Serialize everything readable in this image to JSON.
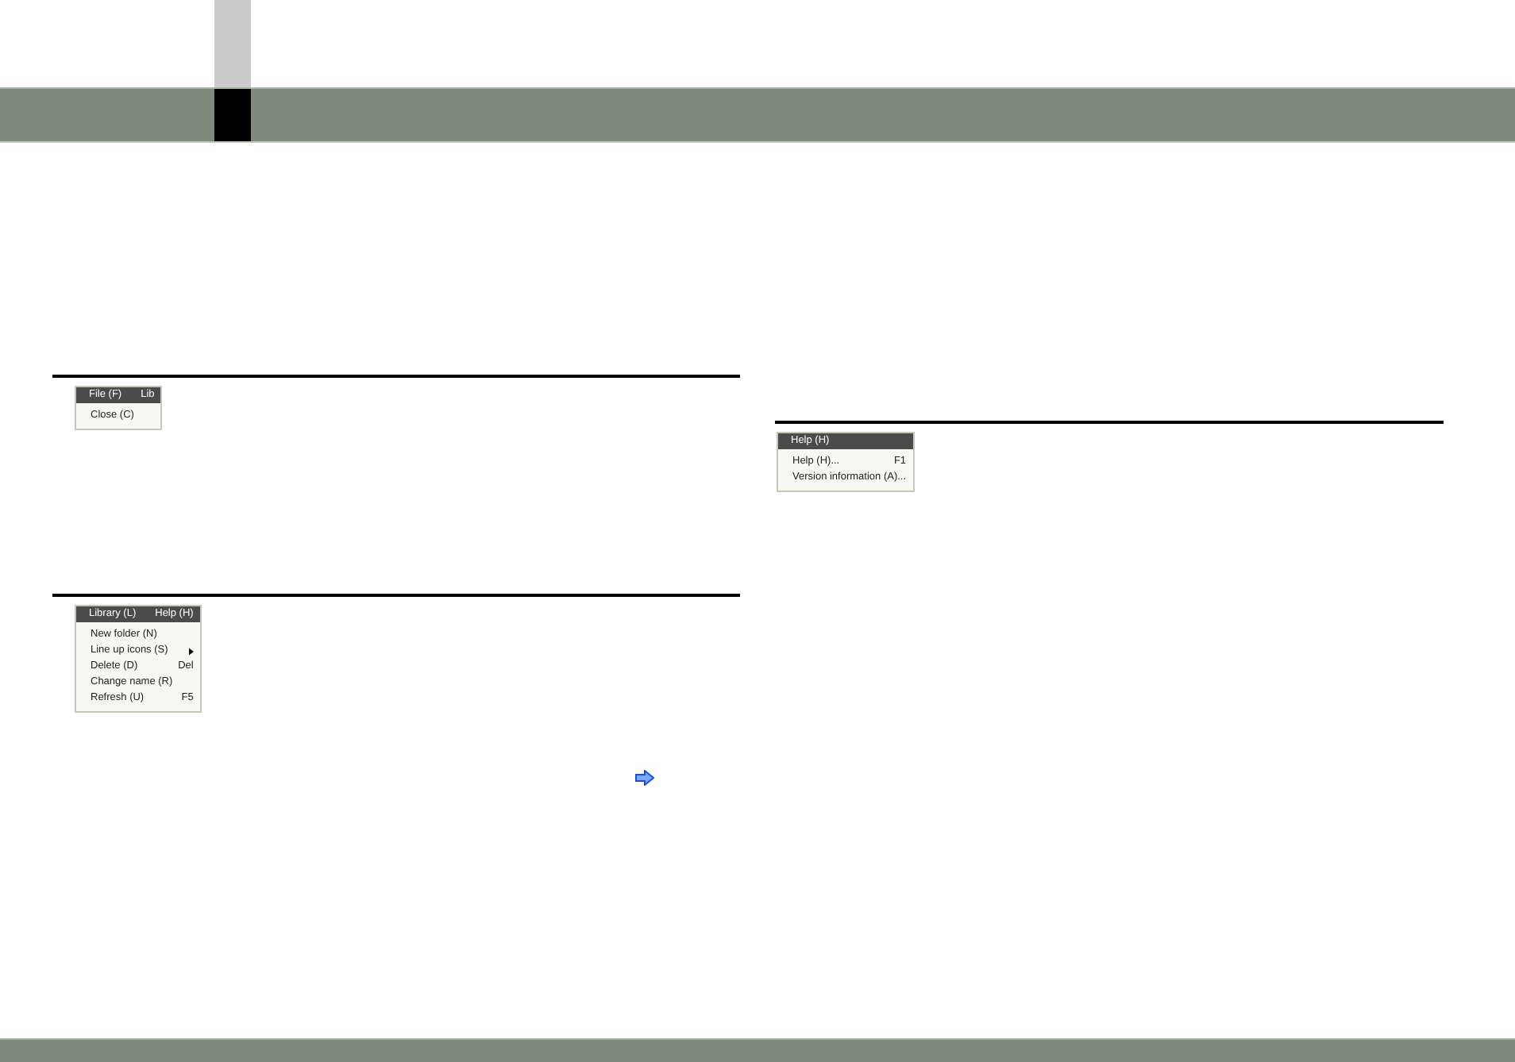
{
  "columns": [
    {
      "sections": [
        {
          "menu": {
            "bar": [
              "File (F)",
              "Lib"
            ],
            "items": [
              {
                "label": "Close (C)",
                "submenu": false
              }
            ]
          }
        },
        {
          "menu": {
            "bar": [
              "Library (L)",
              "Help (H)"
            ],
            "items": [
              {
                "label": "New folder (N)",
                "submenu": false
              },
              {
                "label": "Line up icons (S)",
                "submenu": true
              },
              {
                "label": "Delete (D)",
                "shortcut": "Del",
                "submenu": false
              },
              {
                "label": "Change name (R)",
                "submenu": false
              },
              {
                "label": "Refresh (U)",
                "shortcut": "F5",
                "submenu": false
              }
            ]
          }
        }
      ]
    },
    {
      "sections": [
        {
          "menu": {
            "bar": [
              "Help (H)"
            ],
            "items": [
              {
                "label": "Help (H)...",
                "shortcut": "F1",
                "submenu": false
              },
              {
                "label": "Version information (A)...",
                "submenu": false
              }
            ]
          }
        }
      ]
    }
  ]
}
